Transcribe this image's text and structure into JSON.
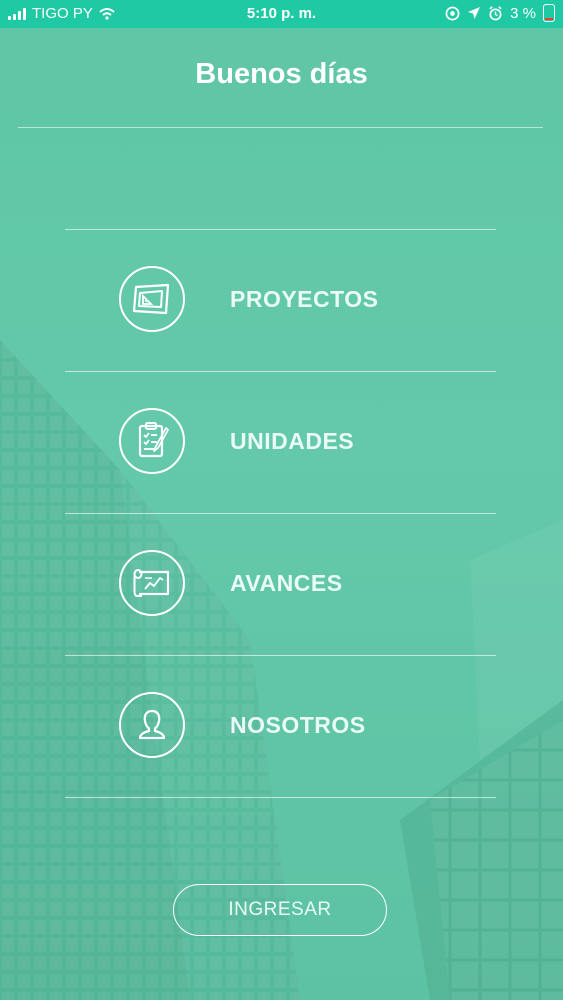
{
  "status_bar": {
    "carrier": "TIGO PY",
    "time": "5:10 p. m.",
    "battery": "3 %",
    "icons": [
      "signal-icon",
      "wifi-icon",
      "location-lock-icon",
      "location-arrow-icon",
      "alarm-icon",
      "battery-icon"
    ]
  },
  "header": {
    "title": "Buenos días"
  },
  "menu": {
    "items": [
      {
        "label": "PROYECTOS",
        "icon": "blueprint-icon"
      },
      {
        "label": "UNIDADES",
        "icon": "clipboard-icon"
      },
      {
        "label": "AVANCES",
        "icon": "chart-scroll-icon"
      },
      {
        "label": "NOSOTROS",
        "icon": "user-icon"
      }
    ]
  },
  "footer": {
    "button_label": "INGRESAR"
  },
  "colors": {
    "background": "#5fc6a5",
    "status_bar": "#1ec9a3",
    "text": "#ffffff"
  }
}
